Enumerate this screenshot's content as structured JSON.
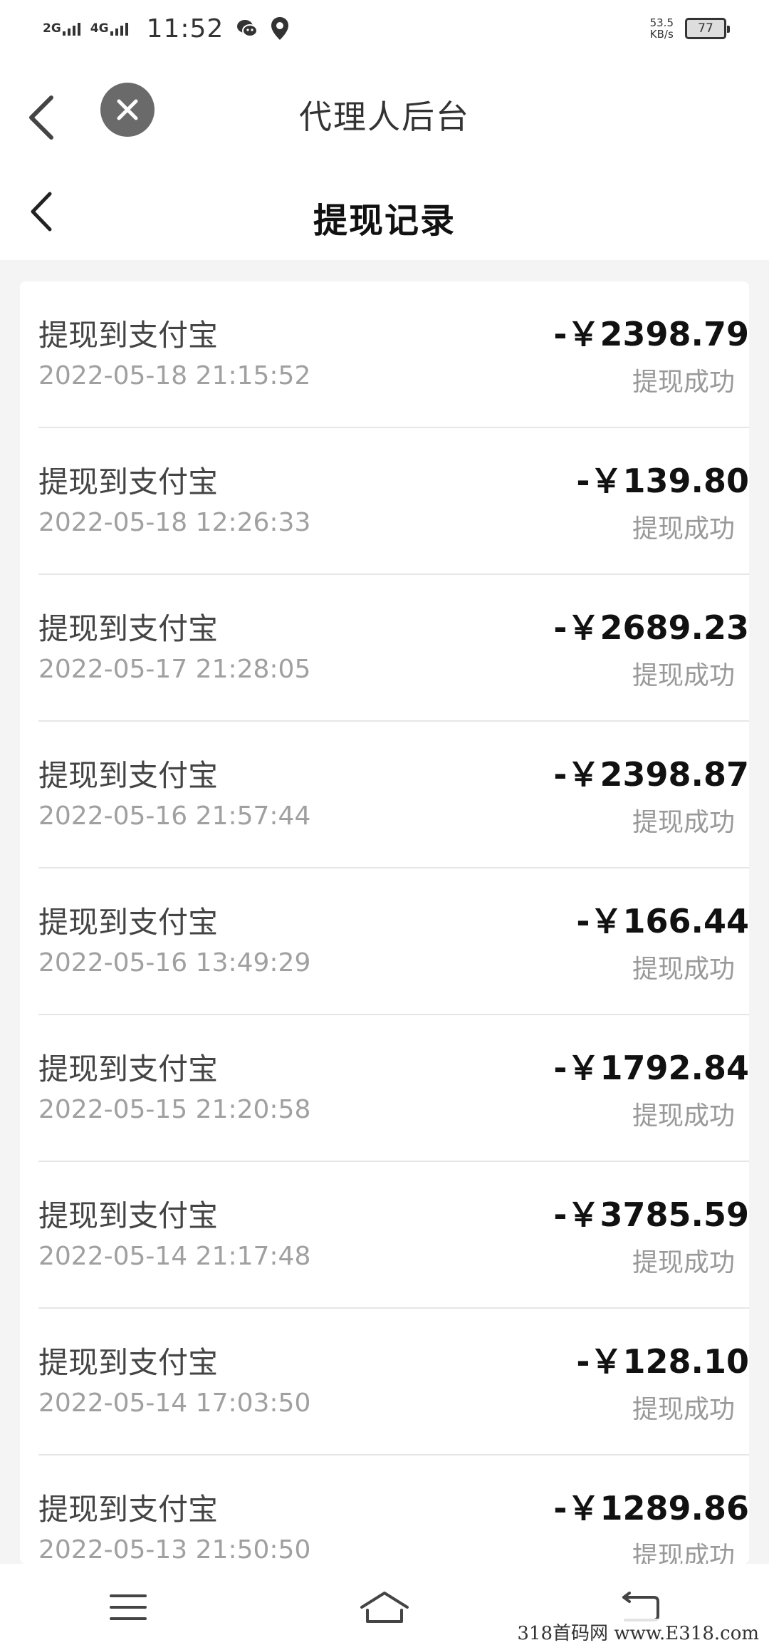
{
  "status_bar": {
    "signal1": "2G",
    "signal2": "4G",
    "time": "11:52",
    "speed_value": "53.5",
    "speed_unit": "KB/s",
    "battery": "77"
  },
  "header": {
    "title": "代理人后台"
  },
  "page": {
    "title": "提现记录"
  },
  "records": [
    {
      "title": "提现到支付宝",
      "date": "2022-05-18 21:15:52",
      "amount": "-￥2398.79",
      "status": "提现成功"
    },
    {
      "title": "提现到支付宝",
      "date": "2022-05-18 12:26:33",
      "amount": "-￥139.80",
      "status": "提现成功"
    },
    {
      "title": "提现到支付宝",
      "date": "2022-05-17 21:28:05",
      "amount": "-￥2689.23",
      "status": "提现成功"
    },
    {
      "title": "提现到支付宝",
      "date": "2022-05-16 21:57:44",
      "amount": "-￥2398.87",
      "status": "提现成功"
    },
    {
      "title": "提现到支付宝",
      "date": "2022-05-16 13:49:29",
      "amount": "-￥166.44",
      "status": "提现成功"
    },
    {
      "title": "提现到支付宝",
      "date": "2022-05-15 21:20:58",
      "amount": "-￥1792.84",
      "status": "提现成功"
    },
    {
      "title": "提现到支付宝",
      "date": "2022-05-14 21:17:48",
      "amount": "-￥3785.59",
      "status": "提现成功"
    },
    {
      "title": "提现到支付宝",
      "date": "2022-05-14 17:03:50",
      "amount": "-￥128.10",
      "status": "提现成功"
    },
    {
      "title": "提现到支付宝",
      "date": "2022-05-13 21:50:50",
      "amount": "-￥1289.86",
      "status": "提现成功"
    }
  ],
  "watermark": "318首码网 www.E318.com"
}
